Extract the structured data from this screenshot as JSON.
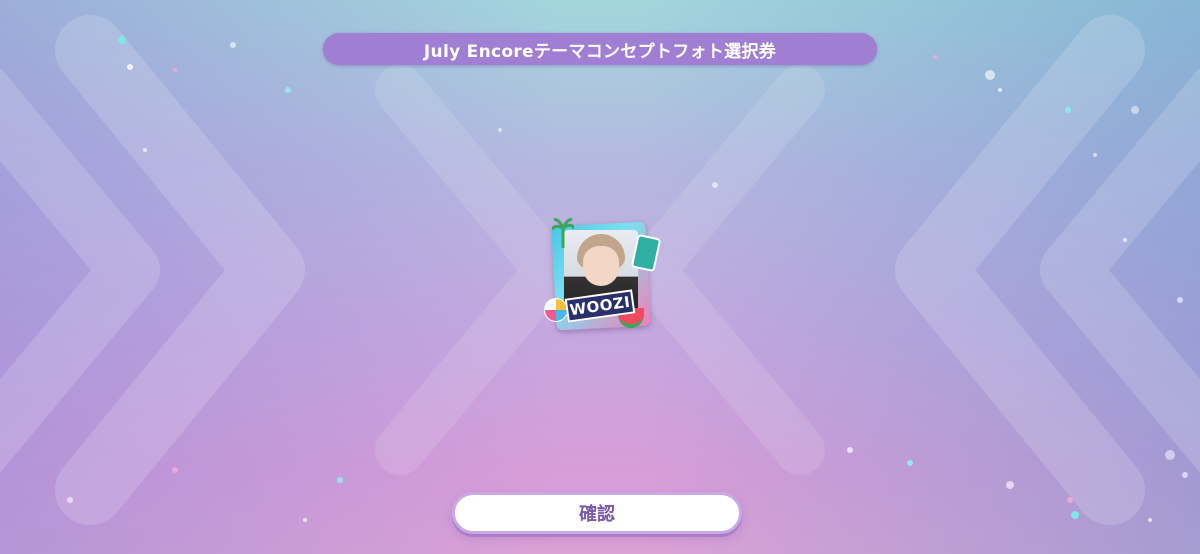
{
  "header": {
    "title": "July Encoreテーマコンセプトフォト選択券"
  },
  "card": {
    "member_name": "WOOZI",
    "icon": "concept-photo-card-icon"
  },
  "footer": {
    "confirm_label": "確認"
  },
  "colors": {
    "title_bar": "#a07ed3",
    "button_text": "#7a5aa8",
    "button_border": "#c8a9e6"
  }
}
